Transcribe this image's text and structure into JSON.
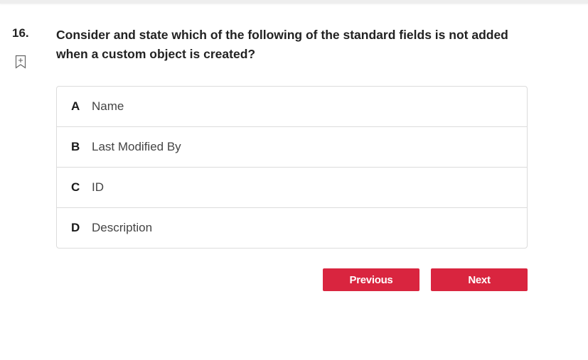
{
  "question": {
    "number": "16.",
    "text": "Consider and state which of the following of the standard fields is not added when a custom object is created?",
    "bookmark_icon": "bookmark-add-icon"
  },
  "options": [
    {
      "letter": "A",
      "text": "Name"
    },
    {
      "letter": "B",
      "text": "Last Modified By"
    },
    {
      "letter": "C",
      "text": "ID"
    },
    {
      "letter": "D",
      "text": "Description"
    }
  ],
  "nav": {
    "previous_label": "Previous",
    "next_label": "Next"
  },
  "colors": {
    "button_bg": "#d9253f",
    "border": "#dcdcdc"
  }
}
